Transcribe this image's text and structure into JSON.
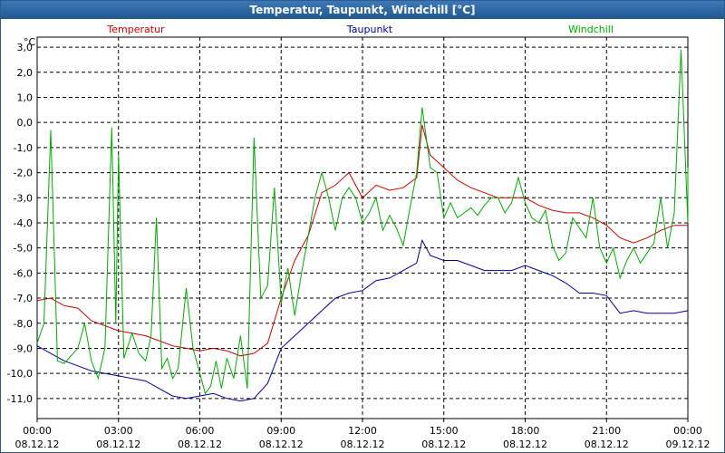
{
  "window": {
    "title": "Temperatur, Taupunkt, Windchill [°C]"
  },
  "chart_data": {
    "type": "line",
    "ylabel": "°C",
    "ylim": [
      -11.8,
      3.4
    ],
    "y_ticks": [
      3.0,
      2.0,
      1.0,
      0.0,
      -1.0,
      -2.0,
      -3.0,
      -4.0,
      -5.0,
      -6.0,
      -7.0,
      -8.0,
      -9.0,
      -10.0,
      -11.0
    ],
    "y_tick_labels": [
      "3,0",
      "2,0",
      "1,0",
      "0,0",
      "-1,0",
      "-2,0",
      "-3,0",
      "-4,0",
      "-5,0",
      "-6,0",
      "-7,0",
      "-8,0",
      "-9,0",
      "-10,0",
      "-11,0"
    ],
    "xlim": [
      0,
      24
    ],
    "x_ticks": [
      0,
      3,
      6,
      9,
      12,
      15,
      18,
      21,
      24
    ],
    "x_tick_times": [
      "00:00",
      "03:00",
      "06:00",
      "09:00",
      "12:00",
      "15:00",
      "18:00",
      "21:00",
      "00:00"
    ],
    "x_tick_dates": [
      "08.12.12",
      "08.12.12",
      "08.12.12",
      "08.12.12",
      "08.12.12",
      "08.12.12",
      "08.12.12",
      "08.12.12",
      "09.12.12"
    ],
    "grid": true,
    "legend_position": "top",
    "series": [
      {
        "name": "Temperatur",
        "color": "#cc0000",
        "points": [
          [
            0,
            -7.1
          ],
          [
            0.5,
            -7.0
          ],
          [
            1.0,
            -7.3
          ],
          [
            1.5,
            -7.4
          ],
          [
            2.0,
            -7.9
          ],
          [
            2.5,
            -8.1
          ],
          [
            3.0,
            -8.3
          ],
          [
            3.5,
            -8.4
          ],
          [
            4.0,
            -8.5
          ],
          [
            4.5,
            -8.7
          ],
          [
            5.0,
            -8.9
          ],
          [
            5.5,
            -9.0
          ],
          [
            6.0,
            -9.1
          ],
          [
            6.5,
            -9.0
          ],
          [
            7.0,
            -9.1
          ],
          [
            7.5,
            -9.3
          ],
          [
            8.0,
            -9.2
          ],
          [
            8.5,
            -8.8
          ],
          [
            9.0,
            -7.0
          ],
          [
            9.5,
            -5.5
          ],
          [
            10.0,
            -4.5
          ],
          [
            10.5,
            -2.8
          ],
          [
            11.0,
            -2.5
          ],
          [
            11.5,
            -2.0
          ],
          [
            12.0,
            -3.0
          ],
          [
            12.5,
            -2.5
          ],
          [
            13.0,
            -2.7
          ],
          [
            13.5,
            -2.6
          ],
          [
            14.0,
            -2.2
          ],
          [
            14.2,
            -0.1
          ],
          [
            14.5,
            -1.3
          ],
          [
            15.0,
            -1.8
          ],
          [
            15.5,
            -2.3
          ],
          [
            16.0,
            -2.6
          ],
          [
            16.5,
            -2.8
          ],
          [
            17.0,
            -3.0
          ],
          [
            17.5,
            -3.0
          ],
          [
            18.0,
            -3.0
          ],
          [
            18.5,
            -3.3
          ],
          [
            19.0,
            -3.5
          ],
          [
            19.5,
            -3.6
          ],
          [
            20.0,
            -3.6
          ],
          [
            20.5,
            -3.8
          ],
          [
            21.0,
            -4.1
          ],
          [
            21.5,
            -4.6
          ],
          [
            22.0,
            -4.8
          ],
          [
            22.5,
            -4.6
          ],
          [
            23.0,
            -4.3
          ],
          [
            23.5,
            -4.1
          ],
          [
            24.0,
            -4.1
          ]
        ]
      },
      {
        "name": "Taupunkt",
        "color": "#000099",
        "points": [
          [
            0,
            -8.9
          ],
          [
            0.5,
            -9.2
          ],
          [
            1.0,
            -9.5
          ],
          [
            1.5,
            -9.7
          ],
          [
            2.0,
            -9.9
          ],
          [
            2.5,
            -10.0
          ],
          [
            3.0,
            -10.1
          ],
          [
            3.5,
            -10.2
          ],
          [
            4.0,
            -10.3
          ],
          [
            4.5,
            -10.6
          ],
          [
            5.0,
            -10.9
          ],
          [
            5.5,
            -11.0
          ],
          [
            6.0,
            -10.9
          ],
          [
            6.5,
            -10.8
          ],
          [
            7.0,
            -11.0
          ],
          [
            7.5,
            -11.1
          ],
          [
            8.0,
            -11.0
          ],
          [
            8.5,
            -10.4
          ],
          [
            9.0,
            -9.0
          ],
          [
            9.5,
            -8.5
          ],
          [
            10.0,
            -8.0
          ],
          [
            10.5,
            -7.5
          ],
          [
            11.0,
            -7.0
          ],
          [
            11.5,
            -6.8
          ],
          [
            12.0,
            -6.7
          ],
          [
            12.5,
            -6.3
          ],
          [
            13.0,
            -6.2
          ],
          [
            13.5,
            -5.9
          ],
          [
            14.0,
            -5.6
          ],
          [
            14.2,
            -4.7
          ],
          [
            14.5,
            -5.3
          ],
          [
            15.0,
            -5.5
          ],
          [
            15.5,
            -5.5
          ],
          [
            16.0,
            -5.7
          ],
          [
            16.5,
            -5.9
          ],
          [
            17.0,
            -5.9
          ],
          [
            17.5,
            -5.9
          ],
          [
            18.0,
            -5.7
          ],
          [
            18.5,
            -5.9
          ],
          [
            19.0,
            -6.1
          ],
          [
            19.5,
            -6.4
          ],
          [
            20.0,
            -6.8
          ],
          [
            20.5,
            -6.8
          ],
          [
            21.0,
            -6.9
          ],
          [
            21.5,
            -7.6
          ],
          [
            22.0,
            -7.5
          ],
          [
            22.5,
            -7.6
          ],
          [
            23.0,
            -7.6
          ],
          [
            23.5,
            -7.6
          ],
          [
            24.0,
            -7.5
          ]
        ]
      },
      {
        "name": "Windchill",
        "color": "#00aa00",
        "points": [
          [
            0,
            -8.8
          ],
          [
            0.25,
            -8.0
          ],
          [
            0.5,
            -0.3
          ],
          [
            0.75,
            -9.5
          ],
          [
            1.0,
            -9.6
          ],
          [
            1.5,
            -9.0
          ],
          [
            1.75,
            -8.0
          ],
          [
            2.0,
            -9.5
          ],
          [
            2.25,
            -10.2
          ],
          [
            2.5,
            -9.0
          ],
          [
            2.75,
            -0.2
          ],
          [
            2.9,
            -8.0
          ],
          [
            3.0,
            -1.3
          ],
          [
            3.2,
            -9.4
          ],
          [
            3.5,
            -8.4
          ],
          [
            3.75,
            -9.2
          ],
          [
            4.0,
            -9.5
          ],
          [
            4.2,
            -8.5
          ],
          [
            4.4,
            -3.8
          ],
          [
            4.6,
            -9.8
          ],
          [
            4.8,
            -9.4
          ],
          [
            5.0,
            -10.2
          ],
          [
            5.2,
            -9.8
          ],
          [
            5.5,
            -6.6
          ],
          [
            5.75,
            -9.0
          ],
          [
            6.0,
            -10.0
          ],
          [
            6.2,
            -10.8
          ],
          [
            6.4,
            -10.5
          ],
          [
            6.6,
            -9.5
          ],
          [
            6.8,
            -10.6
          ],
          [
            7.0,
            -9.4
          ],
          [
            7.25,
            -10.2
          ],
          [
            7.5,
            -8.5
          ],
          [
            7.75,
            -10.6
          ],
          [
            8.0,
            -0.6
          ],
          [
            8.25,
            -7.0
          ],
          [
            8.5,
            -6.5
          ],
          [
            8.75,
            -2.6
          ],
          [
            9.0,
            -7.2
          ],
          [
            9.25,
            -5.8
          ],
          [
            9.5,
            -7.7
          ],
          [
            9.75,
            -6.0
          ],
          [
            10.0,
            -4.5
          ],
          [
            10.25,
            -3.0
          ],
          [
            10.5,
            -2.0
          ],
          [
            10.75,
            -3.0
          ],
          [
            11.0,
            -4.3
          ],
          [
            11.25,
            -3.0
          ],
          [
            11.5,
            -2.6
          ],
          [
            11.75,
            -3.0
          ],
          [
            12.0,
            -4.0
          ],
          [
            12.25,
            -3.6
          ],
          [
            12.5,
            -3.0
          ],
          [
            12.75,
            -4.3
          ],
          [
            13.0,
            -3.7
          ],
          [
            13.25,
            -4.2
          ],
          [
            13.5,
            -4.9
          ],
          [
            13.75,
            -3.4
          ],
          [
            14.0,
            -2.0
          ],
          [
            14.2,
            0.6
          ],
          [
            14.5,
            -1.8
          ],
          [
            14.75,
            -2.0
          ],
          [
            15.0,
            -3.8
          ],
          [
            15.25,
            -3.2
          ],
          [
            15.5,
            -3.8
          ],
          [
            15.75,
            -3.6
          ],
          [
            16.0,
            -3.4
          ],
          [
            16.25,
            -3.7
          ],
          [
            16.5,
            -3.3
          ],
          [
            16.75,
            -3.0
          ],
          [
            17.0,
            -3.0
          ],
          [
            17.25,
            -3.6
          ],
          [
            17.5,
            -3.2
          ],
          [
            17.75,
            -2.2
          ],
          [
            18.0,
            -3.2
          ],
          [
            18.25,
            -3.8
          ],
          [
            18.5,
            -4.0
          ],
          [
            18.75,
            -3.5
          ],
          [
            19.0,
            -4.9
          ],
          [
            19.25,
            -5.5
          ],
          [
            19.5,
            -5.2
          ],
          [
            19.75,
            -3.8
          ],
          [
            20.0,
            -4.2
          ],
          [
            20.25,
            -4.6
          ],
          [
            20.5,
            -3.0
          ],
          [
            20.75,
            -5.0
          ],
          [
            21.0,
            -5.6
          ],
          [
            21.25,
            -5.0
          ],
          [
            21.5,
            -6.2
          ],
          [
            21.75,
            -5.5
          ],
          [
            22.0,
            -5.0
          ],
          [
            22.25,
            -5.6
          ],
          [
            22.5,
            -5.2
          ],
          [
            22.75,
            -4.8
          ],
          [
            23.0,
            -3.0
          ],
          [
            23.25,
            -5.0
          ],
          [
            23.5,
            -3.6
          ],
          [
            23.75,
            2.9
          ],
          [
            24.0,
            -4.0
          ],
          [
            24.0,
            -1.8
          ]
        ]
      }
    ]
  }
}
